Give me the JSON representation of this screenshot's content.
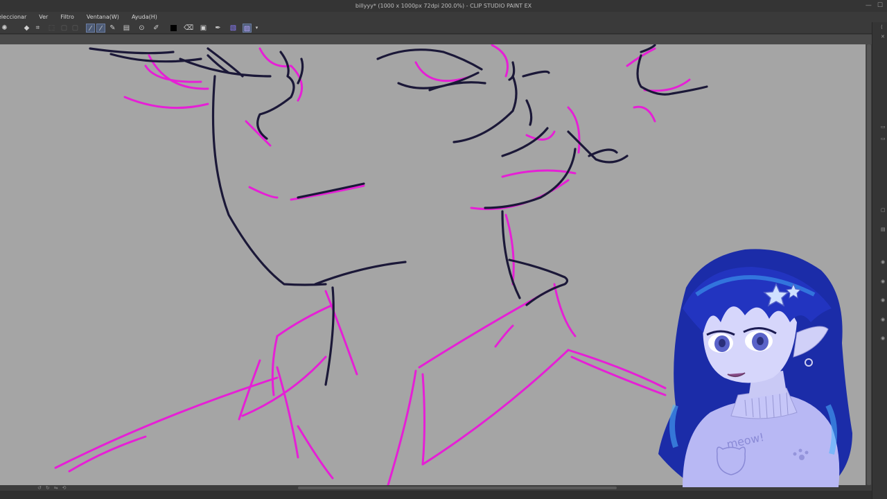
{
  "window": {
    "title": "billyyy* (1000 x 1000px 72dpi 200.0%)  - CLIP STUDIO PAINT EX",
    "controls": [
      "—",
      "☐"
    ]
  },
  "menu": {
    "items": [
      "eleccionar",
      "Ver",
      "Filtro",
      "Ventana(W)",
      "Ayuda(H)"
    ]
  },
  "toolbar": {
    "icons": [
      "sun-icon",
      "diamond-icon",
      "crop-icon",
      "transform-icon",
      "select-icon",
      "pen-icon",
      "pen-icon",
      "pen-icon",
      "ruler-icon",
      "lasso-icon",
      "pencil-icon",
      "color-swatch",
      "brush-icon",
      "eraser-icon",
      "eyedropper-icon",
      "layer-icon",
      "layer-active-icon"
    ]
  },
  "colors": {
    "canvas_bg": "#a5a5a5",
    "lineart": "#1b1838",
    "sketch": "#e61fd6",
    "avatar_hair": "#1d2fb0",
    "avatar_sweater": "#b8b8f4"
  },
  "avatar": {
    "shirt_text": "meow!"
  }
}
